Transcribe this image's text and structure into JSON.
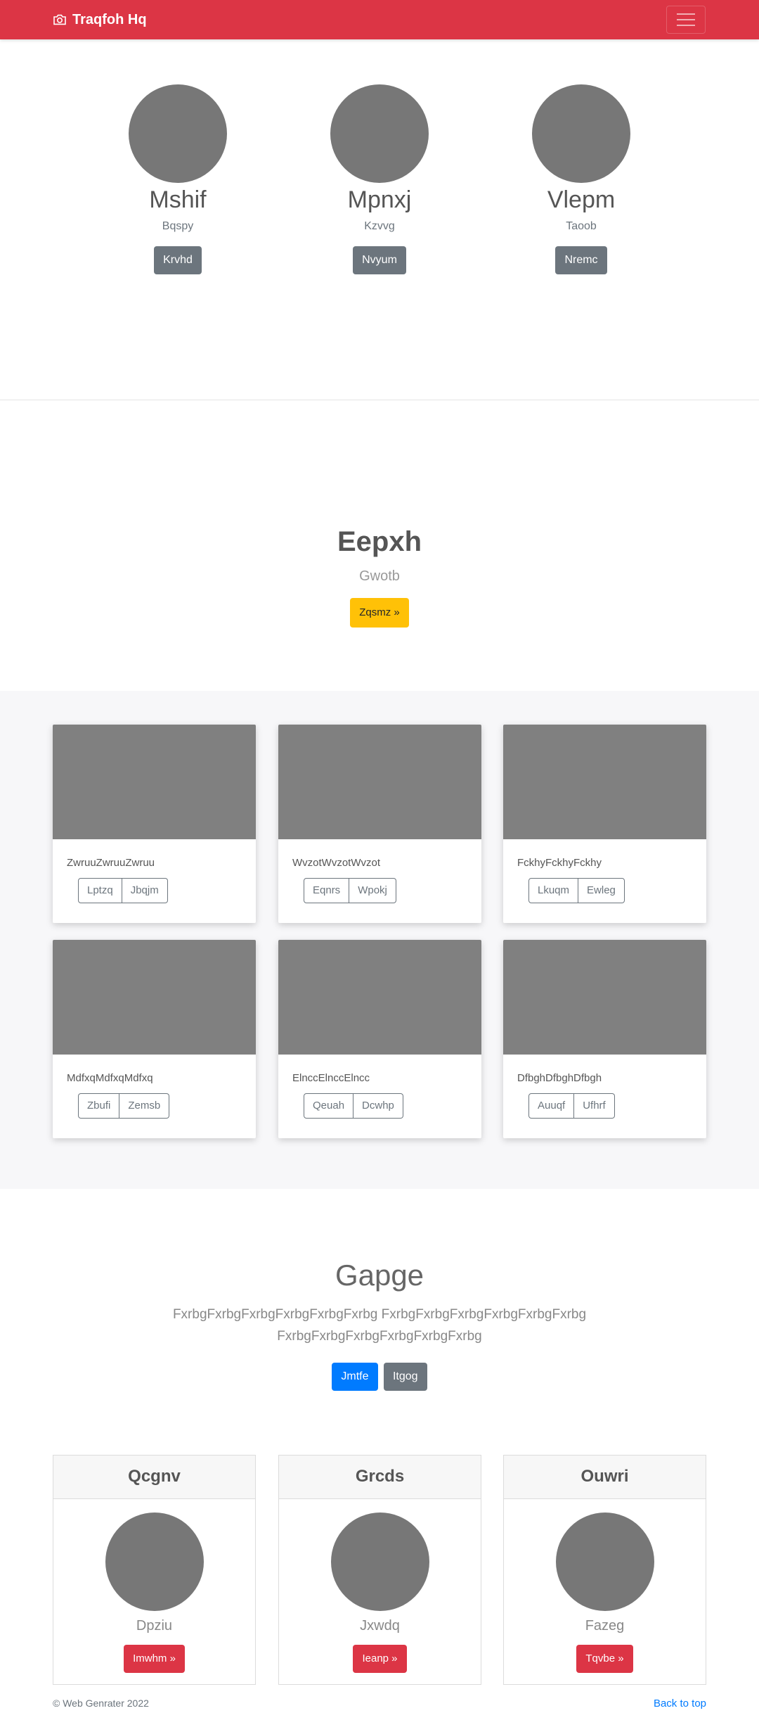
{
  "navbar": {
    "brand": "Traqfoh Hq",
    "brand_icon": "camera-icon",
    "toggler_icon": "hamburger-menu-icon"
  },
  "team": [
    {
      "name": "Mshif",
      "sub": "Bqspy",
      "button": "Krvhd"
    },
    {
      "name": "Mpnxj",
      "sub": "Kzvvg",
      "button": "Nvyum"
    },
    {
      "name": "Vlepm",
      "sub": "Taoob",
      "button": "Nremc"
    }
  ],
  "hero": {
    "title": "Eepxh",
    "subtitle": "Gwotb",
    "button": "Zqsmz »"
  },
  "album": [
    {
      "text": "ZwruuZwruuZwruu",
      "btn1": "Lptzq",
      "btn2": "Jbqjm"
    },
    {
      "text": "WvzotWvzotWvzot",
      "btn1": "Eqnrs",
      "btn2": "Wpokj"
    },
    {
      "text": "FckhyFckhyFckhy",
      "btn1": "Lkuqm",
      "btn2": "Ewleg"
    },
    {
      "text": "MdfxqMdfxqMdfxq",
      "btn1": "Zbufi",
      "btn2": "Zemsb"
    },
    {
      "text": "ElnccElnccElncc",
      "btn1": "Qeuah",
      "btn2": "Dcwhp"
    },
    {
      "text": "DfbghDfbghDfbgh",
      "btn1": "Auuqf",
      "btn2": "Ufhrf"
    }
  ],
  "jumbo": {
    "title": "Gapge",
    "lead": "FxrbgFxrbgFxrbgFxrbgFxrbgFxrbg FxrbgFxrbgFxrbgFxrbgFxrbgFxrbg FxrbgFxrbgFxrbgFxrbgFxrbgFxrbg",
    "primary_button": "Jmtfe",
    "secondary_button": "Itgog"
  },
  "pricing": [
    {
      "header": "Qcgnv",
      "sub": "Dpziu",
      "button": "Imwhm »"
    },
    {
      "header": "Grcds",
      "sub": "Jxwdq",
      "button": "Ieanp »"
    },
    {
      "header": "Ouwri",
      "sub": "Fazeg",
      "button": "Tqvbe »"
    }
  ],
  "footer": {
    "copyright": "© Web Genrater 2022",
    "back_to_top": "Back to top"
  },
  "colors": {
    "navbar": "#dc3545",
    "primary": "#007bff",
    "secondary": "#6c757d",
    "warning": "#ffc107",
    "danger": "#dc3545"
  }
}
